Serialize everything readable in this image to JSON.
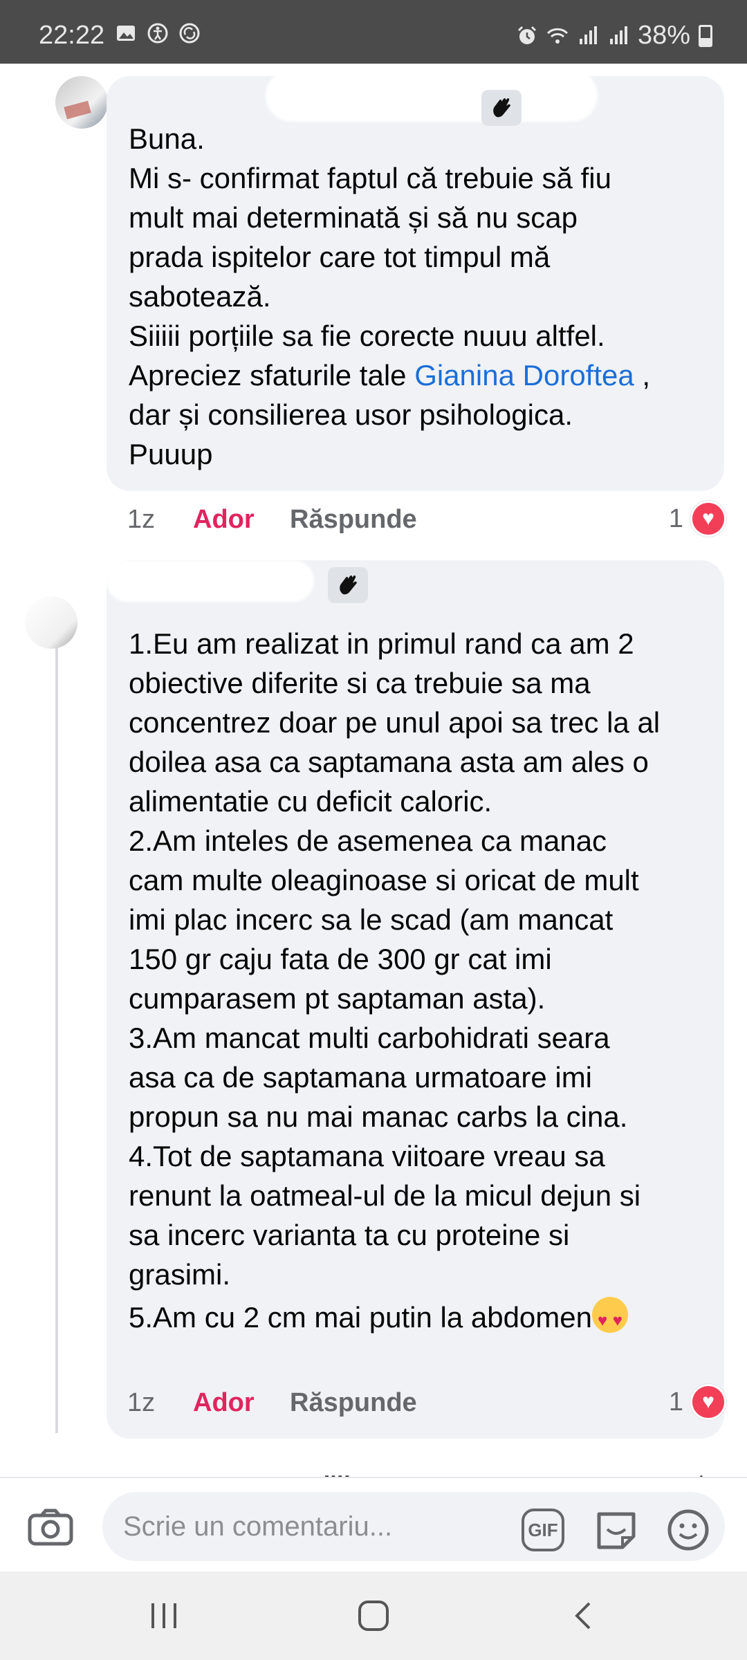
{
  "status_bar": {
    "time": "22:22",
    "battery": "38%",
    "icons": [
      "image-icon",
      "accessibility-icon",
      "sync-icon",
      "alarm-icon",
      "wifi-icon",
      "signal-icon",
      "signal-icon",
      "battery-icon"
    ]
  },
  "comments": [
    {
      "author_visible": "",
      "lines": [
        "Buna.",
        "Mi s- confirmat faptul că trebuie să fiu",
        "mult mai determinată și să nu scap",
        "prada ispitelor care tot timpul mă",
        "sabotează.",
        "Siiiii porțiile sa fie corecte nuuu altfel."
      ],
      "mention_prefix": "Apreciez sfaturile tale ",
      "mention": "Gianina Doroftea",
      "mention_suffix": " ,",
      "lines_after": [
        "dar și consilierea usor psihologica.",
        "Puuup"
      ],
      "time": "1z",
      "react_label": "Ador",
      "reply_label": "Răspunde",
      "reaction_count": "1",
      "reaction_type": "love"
    },
    {
      "author_visible": "",
      "lines": [
        "1.Eu am realizat in primul rand ca am 2",
        "obiective diferite si ca trebuie sa ma",
        "concentrez doar pe unul apoi sa trec la al",
        "doilea asa ca saptamana asta am ales o",
        "alimentatie cu deficit caloric.",
        "2.Am inteles de asemenea ca manac",
        "cam multe oleaginoase si oricat de mult",
        "imi plac incerc sa le scad (am mancat",
        "150 gr caju fata de 300 gr cat imi",
        "cumparasem pt saptaman asta).",
        "3.Am mancat multi carbohidrati seara",
        "asa ca de saptamana urmatoare imi",
        "propun sa nu mai manac carbs la cina.",
        "4.Tot de saptamana viitoare vreau sa",
        "renunt la oatmeal-ul de la micul dejun si",
        "sa incerc varianta ta cu proteine si",
        "grasimi."
      ],
      "last_line": "5.Am cu 2 cm mai putin la abdomen",
      "last_emoji": "heart-eyes-emoji",
      "time": "1z",
      "react_label": "Ador",
      "reply_label": "Răspunde",
      "reaction_count": "1",
      "reaction_type": "love"
    }
  ],
  "peek": {
    "name_fragment": "...Jite",
    "truncated": "l..."
  },
  "composer": {
    "placeholder": "Scrie un comentariu...",
    "gif_label": "GIF"
  },
  "colors": {
    "status_bar_bg": "#4b4b4b",
    "bubble_bg": "#f0f2f5",
    "mention": "#1a6ed8",
    "react_love": "#e0245e",
    "meta_gray": "#65676b"
  }
}
